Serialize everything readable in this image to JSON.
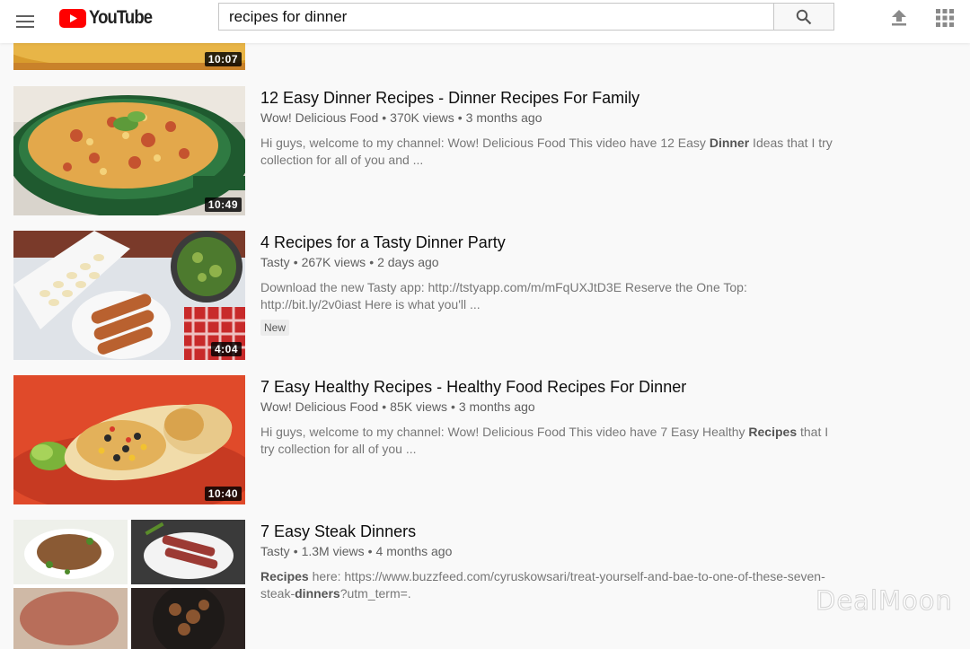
{
  "header": {
    "logo_text": "YouTube",
    "search_value": "recipes for dinner"
  },
  "partial_result": {
    "duration": "10:07"
  },
  "results": [
    {
      "title": "12 Easy Dinner Recipes - Dinner Recipes For Family",
      "channel": "Wow! Delicious Food",
      "views": "370K views",
      "age": "3 months ago",
      "desc_a": "Hi guys, welcome to my channel: Wow! Delicious Food This video have 12 Easy ",
      "desc_b": "Dinner",
      "desc_c": " Ideas that I try collection for all of you and ...",
      "duration": "10:49"
    },
    {
      "title": "4 Recipes for a Tasty Dinner Party",
      "channel": "Tasty",
      "views": "267K views",
      "age": "2 days ago",
      "desc_a": "Download the new Tasty app: http://tstyapp.com/m/mFqUXJtD3E Reserve the One Top: http://bit.ly/2v0iast Here is what you'll ...",
      "badge": "New",
      "duration": "4:04"
    },
    {
      "title": "7 Easy Healthy Recipes - Healthy Food Recipes For Dinner",
      "channel": "Wow! Delicious Food",
      "views": "85K views",
      "age": "3 months ago",
      "desc_a": "Hi guys, welcome to my channel: Wow! Delicious Food This video have 7 Easy Healthy ",
      "desc_b": "Recipes",
      "desc_c": " that I try collection for all of you ...",
      "duration": "10:40"
    },
    {
      "title": "7 Easy Steak Dinners",
      "channel": "Tasty",
      "views": "1.3M views",
      "age": "4 months ago",
      "desc_a": "Recipes",
      "desc_b": " here: https://www.buzzfeed.com/cyruskowsari/treat-yourself-and-bae-to-one-of-these-seven-steak-",
      "desc_c": "dinners",
      "desc_d": "?utm_term=."
    }
  ],
  "meta_separator": "•",
  "watermark": "DealMoon",
  "colors": {
    "youtube_red": "#ff0000",
    "background": "#f9f9f9"
  }
}
